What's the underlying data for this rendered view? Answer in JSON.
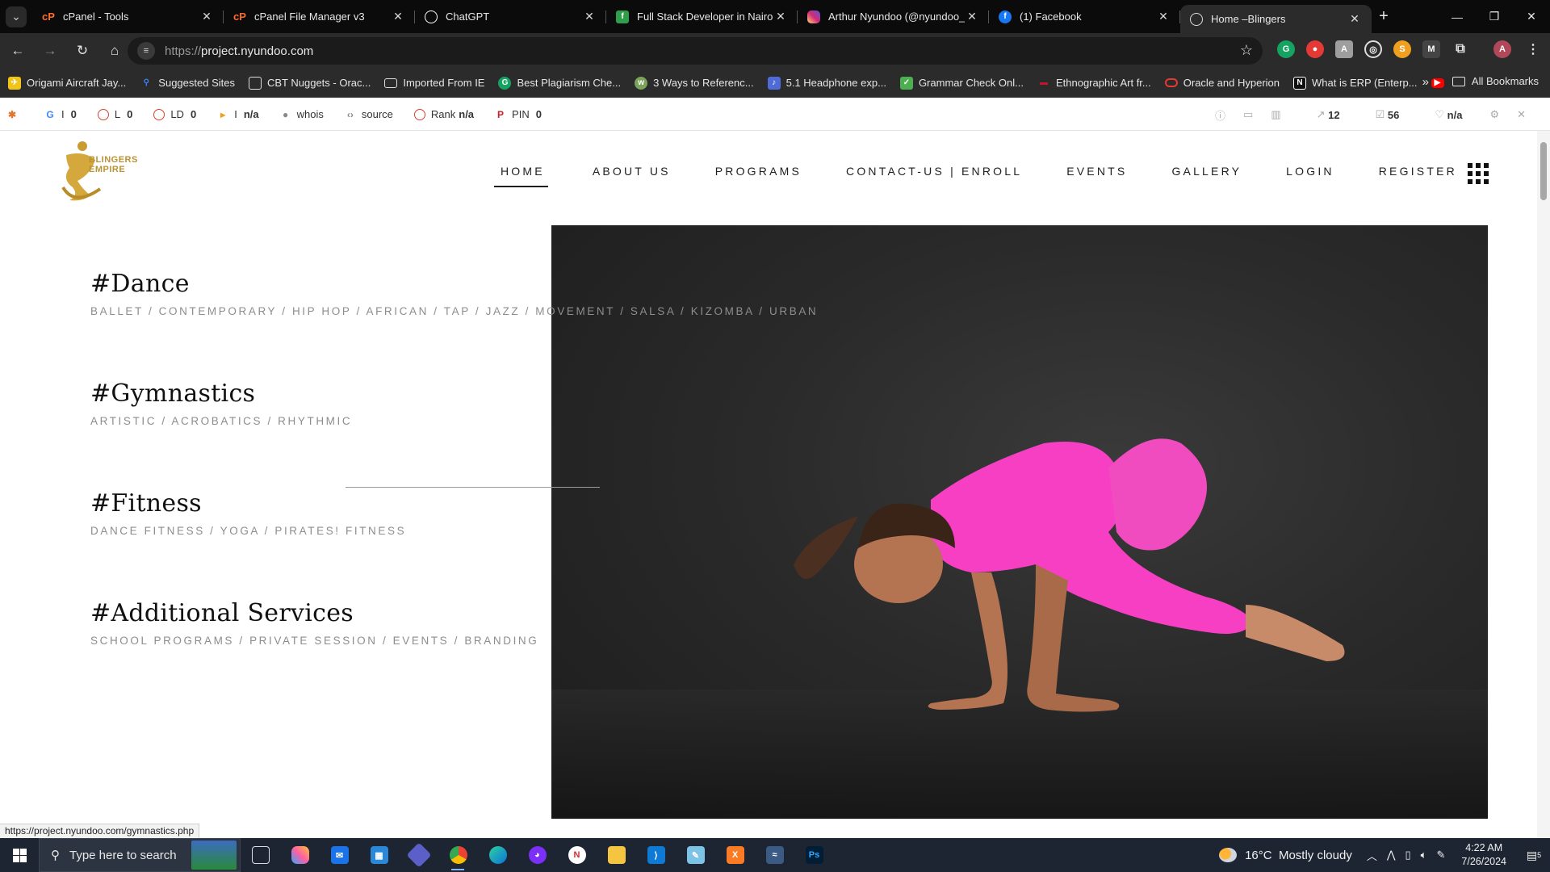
{
  "browser": {
    "tabs": [
      {
        "title": "cPanel - Tools",
        "icon": "cpanel-icon",
        "color": "#ff6c2c"
      },
      {
        "title": "cPanel File Manager v3",
        "icon": "cpanel-icon",
        "color": "#ff6c2c"
      },
      {
        "title": "ChatGPT",
        "icon": "chatgpt-icon",
        "color": "#ffffff"
      },
      {
        "title": "Full Stack Developer in Nairobi",
        "icon": "fuzu-icon",
        "color": "#2f9d49"
      },
      {
        "title": "Arthur Nyundoo (@nyundoo_a",
        "icon": "instagram-icon",
        "color": "#d62976"
      },
      {
        "title": "(1) Facebook",
        "icon": "facebook-icon",
        "color": "#1877f2"
      },
      {
        "title": "Home –Blingers",
        "icon": "page-icon",
        "color": "#dddddd",
        "active": true
      }
    ],
    "address": {
      "scheme": "https://",
      "host": "project.nyundoo.com"
    },
    "bookmarks": [
      {
        "label": "Origami Aircraft Jay...",
        "color": "#f0c419"
      },
      {
        "label": "Suggested Sites",
        "color": "#3b82f6"
      },
      {
        "label": "CBT Nuggets - Orac...",
        "color": "#444444"
      },
      {
        "label": "Imported From IE",
        "color": "#777777"
      },
      {
        "label": "Best Plagiarism Che...",
        "color": "#15a362"
      },
      {
        "label": "3 Ways to Referenc...",
        "color": "#7aa35b"
      },
      {
        "label": "5.1 Headphone exp...",
        "color": "#4f6bd8"
      },
      {
        "label": "Grammar Check Onl...",
        "color": "#4caf50"
      },
      {
        "label": "Ethnographic  Art fr...",
        "color": "#c4122f"
      },
      {
        "label": "Oracle and Hyperion",
        "color": "#e53935"
      },
      {
        "label": "What is ERP (Enterp...",
        "color": "#111111"
      }
    ],
    "all_bookmarks": "All Bookmarks",
    "status_url": "https://project.nyundoo.com/gymnastics.php"
  },
  "seo_toolbar": {
    "items": [
      {
        "label": "I",
        "value": "0"
      },
      {
        "label": "L",
        "value": "0"
      },
      {
        "label": "LD",
        "value": "0"
      },
      {
        "label": "I",
        "value": "n/a"
      },
      {
        "label": "whois",
        "value": ""
      },
      {
        "label": "source",
        "value": ""
      },
      {
        "label": "Rank",
        "value": "n/a"
      },
      {
        "label": "PIN",
        "value": "0"
      }
    ],
    "right": {
      "links": "12",
      "pages": "56",
      "trust": "n/a"
    }
  },
  "site": {
    "logo_text": "BLINGERS EMPIRE",
    "nav": [
      "HOME",
      "ABOUT US",
      "PROGRAMS",
      "CONTACT-US | ENROLL",
      "EVENTS",
      "GALLERY",
      "LOGIN",
      "REGISTER"
    ],
    "services": [
      {
        "title": "#Dance",
        "subtitle": "BALLET / CONTEMPORARY / HIP HOP / AFRICAN / TAP / JAZZ / MOVEMENT / SALSA / KIZOMBA / URBAN"
      },
      {
        "title": "#Gymnastics",
        "subtitle": "ARTISTIC / ACROBATICS / RHYTHMIC"
      },
      {
        "title": "#Fitness",
        "subtitle": "DANCE FITNESS / YOGA / PIRATES! FITNESS"
      },
      {
        "title": "#Additional Services",
        "subtitle": "SCHOOL PROGRAMS / PRIVATE SESSION / EVENTS / BRANDING"
      }
    ],
    "hero_subject_color": "#f73fc4"
  },
  "taskbar": {
    "search_placeholder": "Type here to search",
    "weather": {
      "temp": "16°C",
      "condition": "Mostly cloudy"
    },
    "time": "4:22 AM",
    "date": "7/26/2024",
    "notifications": "5"
  }
}
